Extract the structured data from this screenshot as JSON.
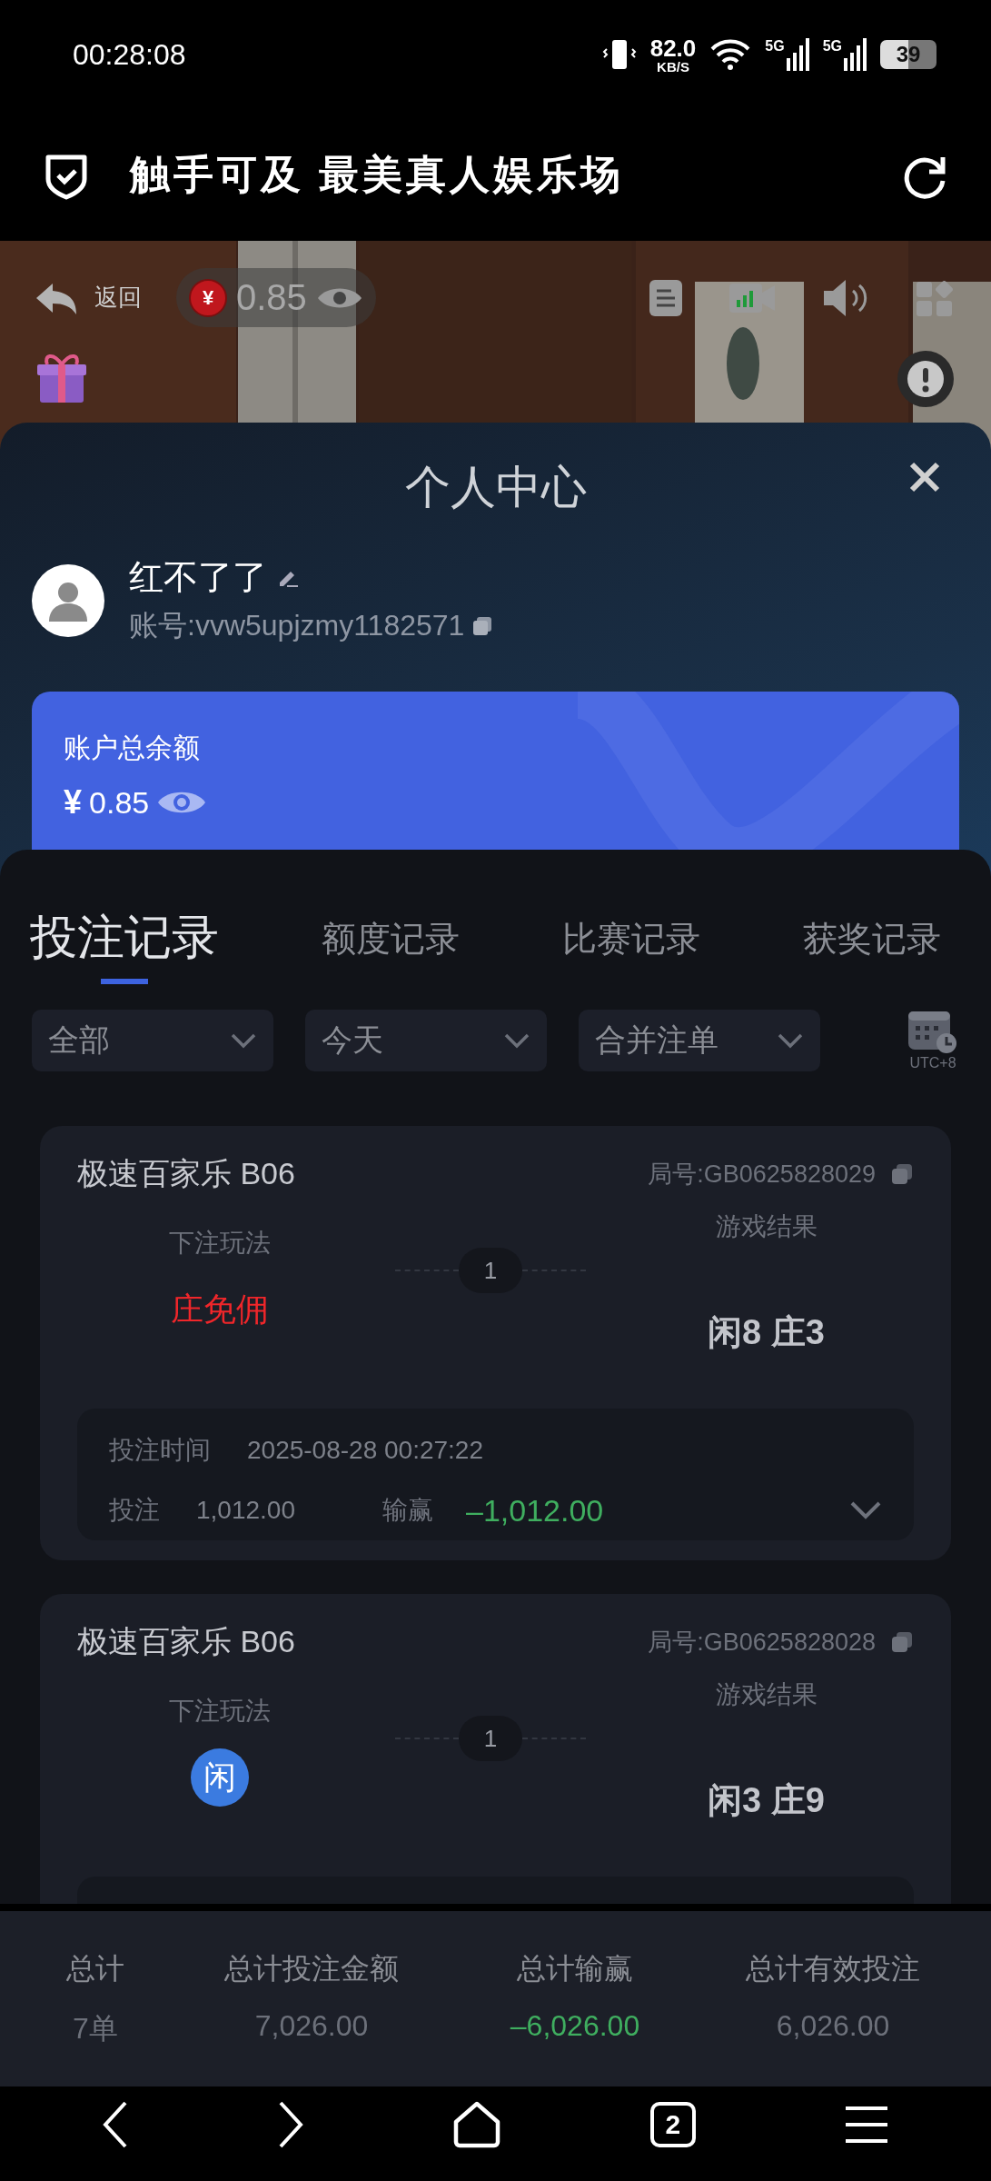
{
  "status_bar": {
    "time": "00:28:08",
    "net_speed": "82.0",
    "net_unit": "KB/S",
    "networks": [
      "5G",
      "5G"
    ],
    "battery": "39"
  },
  "header": {
    "title": "触手可及 最美真人娱乐场"
  },
  "stage": {
    "back_label": "返回",
    "currency": "¥",
    "balance": "0.85"
  },
  "profile_panel": {
    "title": "个人中心",
    "nickname": "红不了了",
    "account": "账号:vvw5upjzmy1182571",
    "balance_card": {
      "label": "账户总余额",
      "currency": "¥",
      "amount": "0.85"
    }
  },
  "tabs": [
    {
      "label": "投注记录",
      "selected": true
    },
    {
      "label": "额度记录",
      "selected": false
    },
    {
      "label": "比赛记录",
      "selected": false
    },
    {
      "label": "获奖记录",
      "selected": false
    }
  ],
  "filters": [
    {
      "value": "全部"
    },
    {
      "value": "今天"
    },
    {
      "value": "合并注单"
    }
  ],
  "timezone": "UTC+8",
  "bets": [
    {
      "game": "极速百家乐 B06",
      "round": "局号:GB0625828029",
      "bet_label": "下注玩法",
      "kind": "text",
      "bet": "庄免佣",
      "count": "1",
      "result_label": "游戏结果",
      "result": "闲8 庄3",
      "time_label": "投注时间",
      "time": "2025-08-28 00:27:22",
      "stake_label": "投注",
      "stake": "1,012.00",
      "payout_label": "输赢",
      "payout": "–1,012.00"
    },
    {
      "game": "极速百家乐 B06",
      "round": "局号:GB0625828028",
      "bet_label": "下注玩法",
      "kind": "badge",
      "bet": "闲",
      "count": "1",
      "result_label": "游戏结果",
      "result": "闲3 庄9"
    }
  ],
  "totals": [
    {
      "label": "总计",
      "value": "7单",
      "kind": "plain"
    },
    {
      "label": "总计投注金额",
      "value": "7,026.00",
      "kind": "plain"
    },
    {
      "label": "总计输赢",
      "value": "–6,026.00",
      "kind": "payout"
    },
    {
      "label": "总计有效投注",
      "value": "6,026.00",
      "kind": "plain"
    }
  ],
  "nav_bar": {
    "tab_count": "2"
  }
}
